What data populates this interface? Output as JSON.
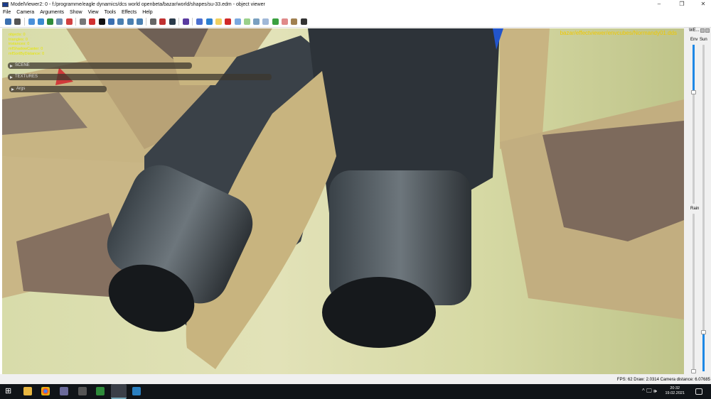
{
  "window": {
    "title": "ModelViewer2: 0 - f:/programme/eagle dynamics/dcs world openbeta/bazar/world/shapes/su-33.edm - object viewer",
    "controls": [
      "–",
      "❐",
      "✕"
    ]
  },
  "menu": [
    "File",
    "Camera",
    "Arguments",
    "Show",
    "View",
    "Tools",
    "Effects",
    "Help"
  ],
  "toolbar_icons": [
    "save-icon",
    "user-icon",
    "sphere-icon",
    "rotate-icon",
    "refresh-icon",
    "image-icon",
    "runner-icon",
    "gear-icon",
    "crosshair-icon",
    "black-square-icon",
    "funnel-icon",
    "flask-icon",
    "arrow-left-icon",
    "arrow-right-icon",
    "portrait-icon",
    "rgb-icon",
    "monitor-icon",
    "undo-icon",
    "bar-chart-icon",
    "blue-dot-icon",
    "copy-icon",
    "red-cube-icon",
    "blue-sphere-icon",
    "green-sphere-icon",
    "skeleton-icon",
    "list-icon",
    "grid-icon",
    "target-icon",
    "lamp-icon",
    "pin-icon"
  ],
  "stats": [
    "objects: 0",
    "triangles: 0",
    "instances: 0",
    "mfShadowCaster: 0",
    "mfSortByDistance: 0"
  ],
  "panels": {
    "scene": "SCENE",
    "textures": "TEXTURES",
    "args": "Args"
  },
  "env_texture": "bazar/effectviewer/envcubes/Normandy01.dds",
  "weather": {
    "title": "WE...",
    "env_label": "Env",
    "sun_label": "Sun",
    "rain_label": "Rain",
    "env_value": 0.7,
    "sun_value": 0.12,
    "rain_value": 0
  },
  "status": "FPS: 62  Draw: 2.0314  Camera distance: 6.07685",
  "taskbar": {
    "time": "20:32",
    "date": "19.02.2021",
    "tray": "^  🖵  🕪"
  },
  "colors": {
    "accent": "#1e88e5",
    "stats": "#e6e600",
    "path": "#f0c800"
  }
}
